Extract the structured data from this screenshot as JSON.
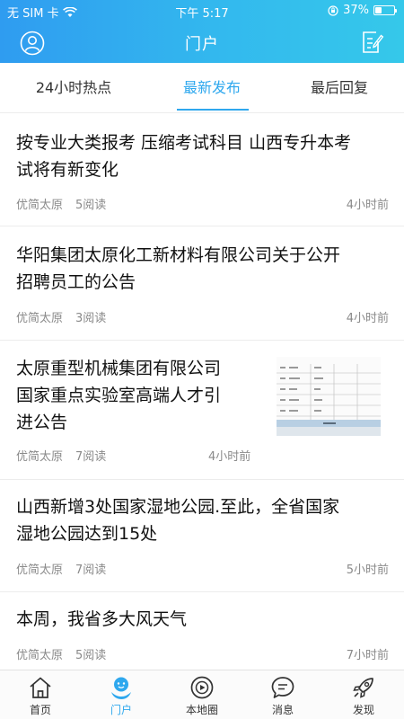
{
  "status": {
    "carrier": "无 SIM 卡",
    "time": "下午 5:17",
    "battery": "37%",
    "battery_level": 0.37
  },
  "nav": {
    "title": "门户"
  },
  "tabs": [
    {
      "label": "24小时热点"
    },
    {
      "label": "最新发布"
    },
    {
      "label": "最后回复"
    }
  ],
  "articles": [
    {
      "title_line1": "按专业大类报考 压缩考试科目 山西专升本考",
      "title_line2": "试将有新变化",
      "title_line3": "",
      "source": "优简太原",
      "reads": "5阅读",
      "time": "4小时前"
    },
    {
      "title_line1": "华阳集团太原化工新材料有限公司关于公开",
      "title_line2": "招聘员工的公告",
      "title_line3": "",
      "source": "优简太原",
      "reads": "3阅读",
      "time": "4小时前"
    },
    {
      "title_line1": "太原重型机械集团有限公司",
      "title_line2": "国家重点实验室高端人才引",
      "title_line3": "进公告",
      "source": "优简太原",
      "reads": "7阅读",
      "time": "4小时前"
    },
    {
      "title_line1": "山西新增3处国家湿地公园.至此，全省国家",
      "title_line2": "湿地公园达到15处",
      "title_line3": "",
      "source": "优简太原",
      "reads": "7阅读",
      "time": "5小时前"
    },
    {
      "title_line1": "本周，我省多大风天气",
      "title_line2": "",
      "title_line3": "",
      "source": "优简太原",
      "reads": "5阅读",
      "time": "7小时前"
    }
  ],
  "tabbar": [
    {
      "label": "首页",
      "icon": "home-icon"
    },
    {
      "label": "门户",
      "icon": "portal-icon"
    },
    {
      "label": "本地圈",
      "icon": "local-circle-icon"
    },
    {
      "label": "消息",
      "icon": "message-icon"
    },
    {
      "label": "发现",
      "icon": "rocket-icon"
    }
  ],
  "colors": {
    "accent": "#2fa8ee",
    "header_start": "#2f9cf0",
    "header_end": "#35c8ea"
  }
}
